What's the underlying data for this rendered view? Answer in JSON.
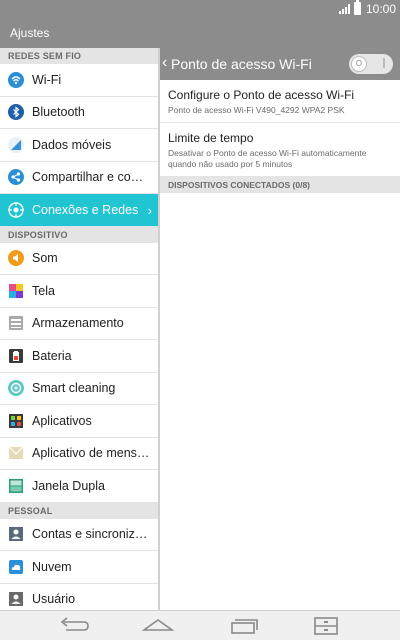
{
  "status": {
    "time": "10:00"
  },
  "header": {
    "title": "Ajustes"
  },
  "left": {
    "sections": [
      {
        "label": "REDES SEM FIO",
        "items": [
          {
            "label": "Wi-Fi",
            "icon": "wifi-icon"
          },
          {
            "label": "Bluetooth",
            "icon": "bluetooth-icon"
          },
          {
            "label": "Dados móveis",
            "icon": "mobile-data-icon"
          },
          {
            "label": "Compartilhar e con…",
            "icon": "share-icon"
          },
          {
            "label": "Conexões e Redes",
            "icon": "connections-icon",
            "active": true
          }
        ]
      },
      {
        "label": "DISPOSITIVO",
        "items": [
          {
            "label": "Som",
            "icon": "sound-icon"
          },
          {
            "label": "Tela",
            "icon": "display-icon"
          },
          {
            "label": "Armazenamento",
            "icon": "storage-icon"
          },
          {
            "label": "Bateria",
            "icon": "battery-icon"
          },
          {
            "label": "Smart cleaning",
            "icon": "smart-cleaning-icon"
          },
          {
            "label": "Aplicativos",
            "icon": "apps-icon"
          },
          {
            "label": "Aplicativo de mens…",
            "icon": "messaging-icon"
          },
          {
            "label": "Janela Dupla",
            "icon": "dual-window-icon"
          }
        ]
      },
      {
        "label": "PESSOAL",
        "items": [
          {
            "label": "Contas e sincroniza…",
            "icon": "accounts-icon"
          },
          {
            "label": "Nuvem",
            "icon": "cloud-icon"
          },
          {
            "label": "Usuário",
            "icon": "user-icon"
          }
        ]
      }
    ]
  },
  "right": {
    "title": "Ponto de acesso Wi-Fi",
    "toggle_state": "off",
    "configure": {
      "title": "Configure o Ponto de acesso Wi-Fi",
      "summary": "Ponto de acesso Wi-Fi V490_4292 WPA2 PSK"
    },
    "timeout": {
      "title": "Limite de tempo",
      "summary": "Desativar o Ponto de acesso Wi-Fi automaticamente quando não usado por 5 minutos"
    },
    "connected_section": "DISPOSITIVOS CONECTADOS (0/8)"
  },
  "colors": {
    "accent": "#21c5d2",
    "bar": "#8c8c8c"
  }
}
